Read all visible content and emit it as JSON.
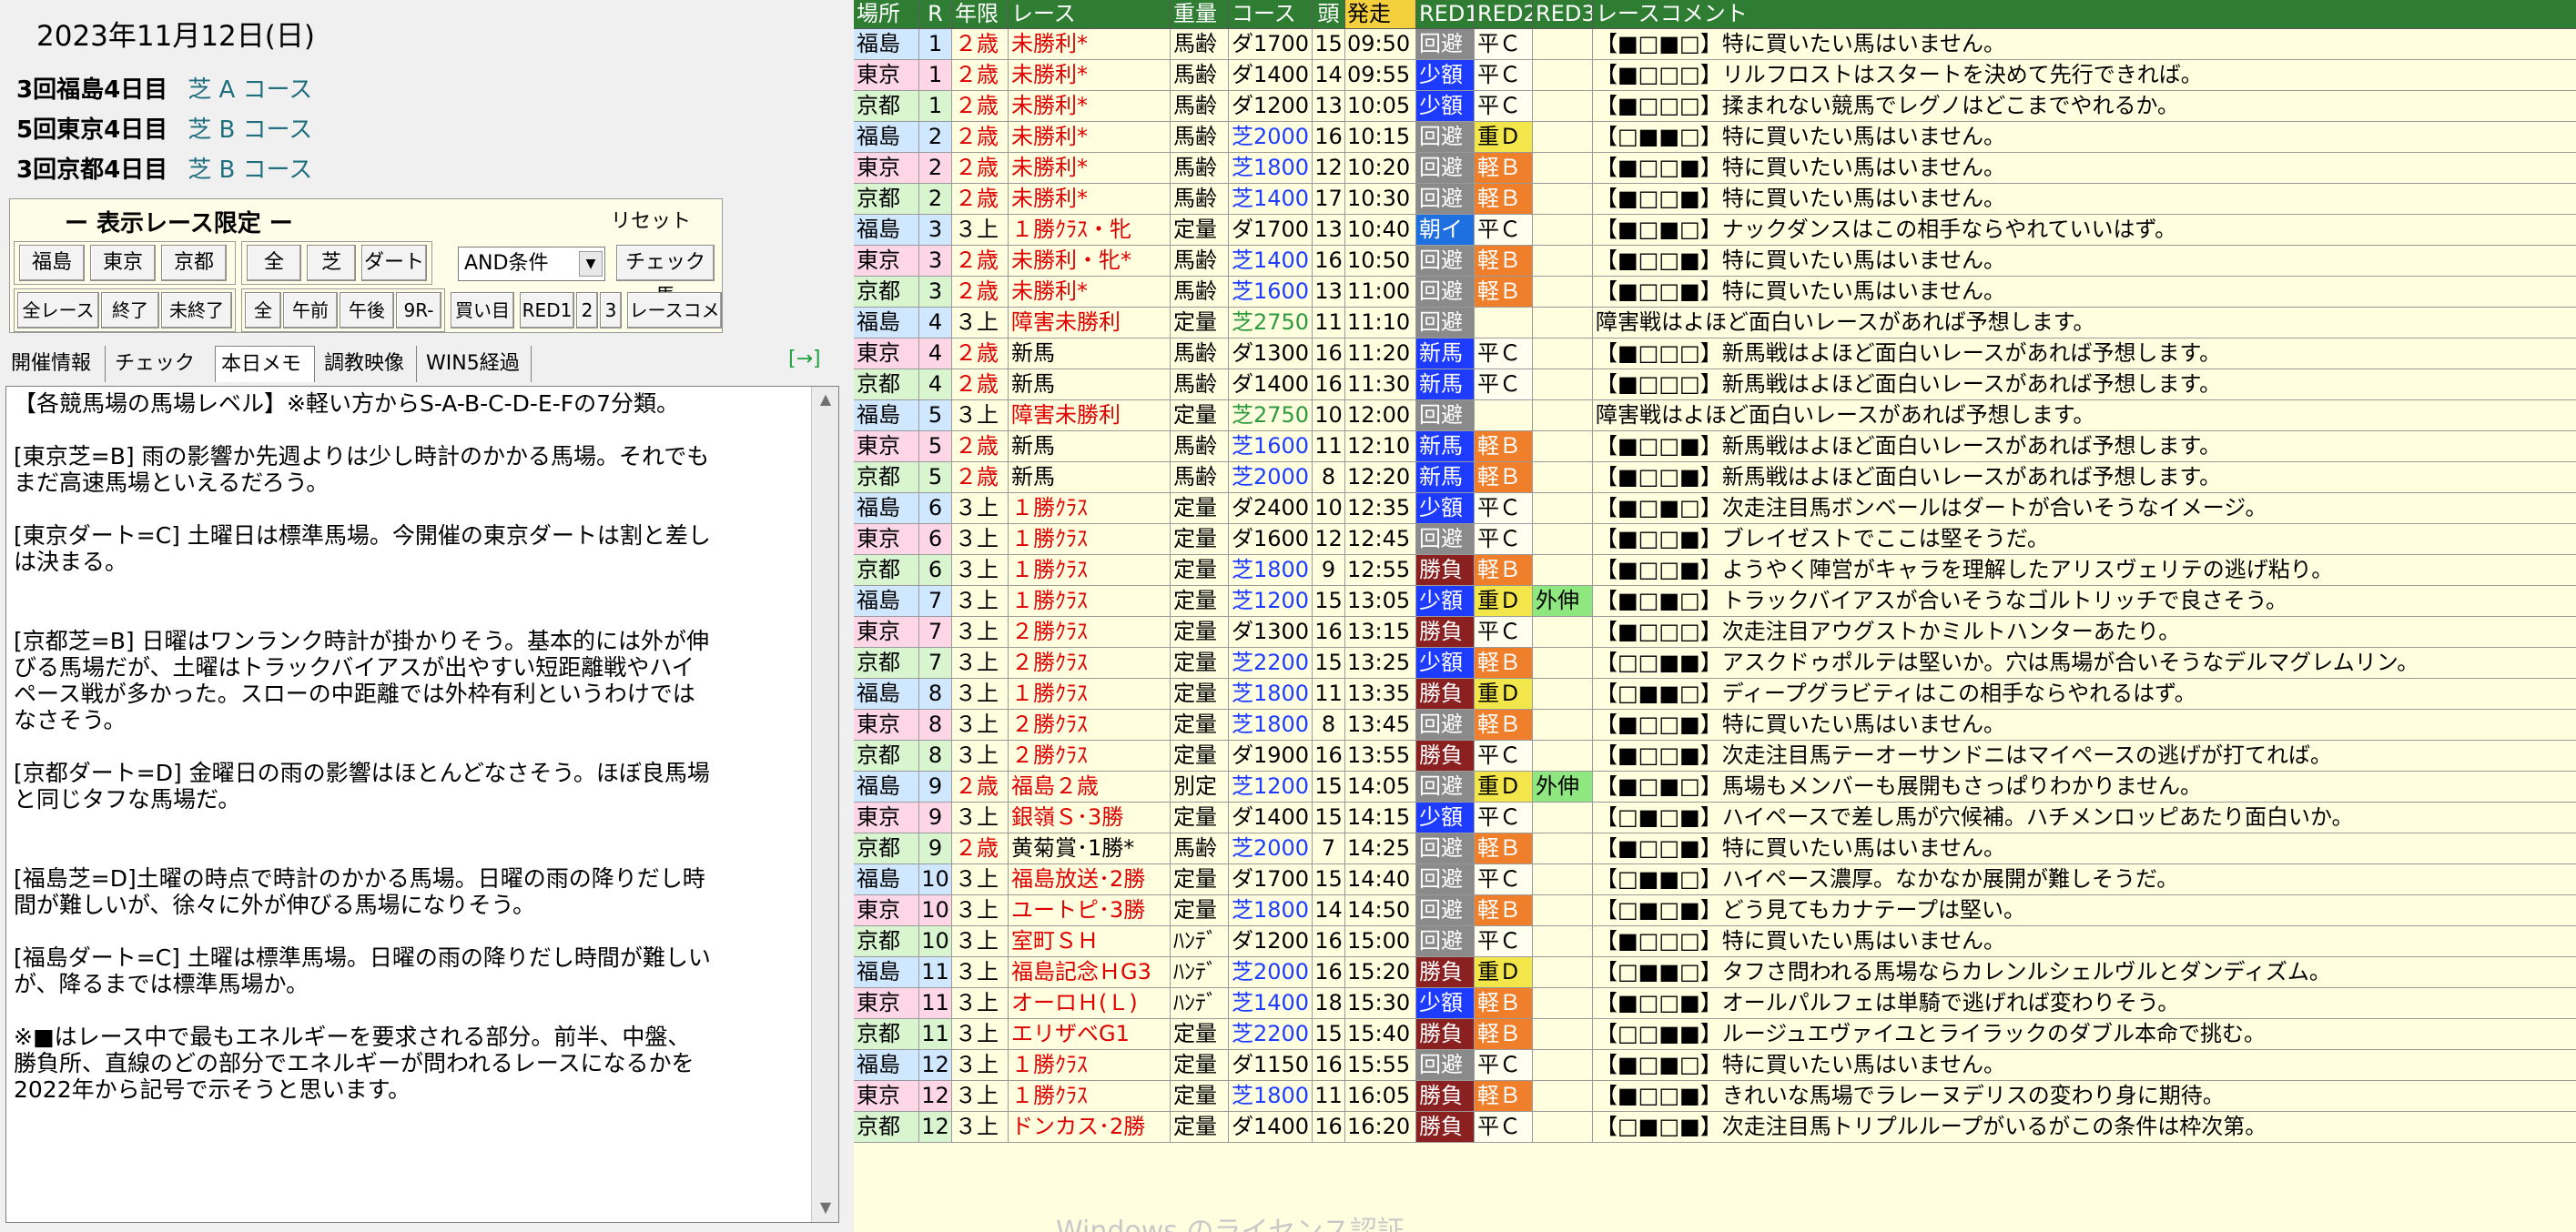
{
  "date": "2023年11月12日(日)",
  "meetings": [
    {
      "name": "3回福島4日目",
      "course": "芝 A コース"
    },
    {
      "name": "5回東京4日目",
      "course": "芝 B コース"
    },
    {
      "name": "3回京都4日目",
      "course": "芝 B コース"
    }
  ],
  "filter": {
    "title": "ー 表示レース限定 ー",
    "reset": "リセット",
    "place_buttons": [
      "福島",
      "東京",
      "京都"
    ],
    "surface_buttons": [
      "全",
      "芝",
      "ダート"
    ],
    "and_condition": "AND条件",
    "check_horse": "チェック馬",
    "row2_buttons": [
      "全レース",
      "終了",
      "未終了"
    ],
    "time_buttons": [
      "全",
      "午前",
      "午後",
      "9R-"
    ],
    "buy_button": "買い目",
    "red_buttons": [
      "RED1",
      "2",
      "3"
    ],
    "comment_button": "レースコメ"
  },
  "tabs": [
    "開催情報",
    "チェック馬",
    "本日メモ",
    "調教映像",
    "WIN5経過"
  ],
  "expand_icon": "[→]",
  "memo": "【各競馬場の馬場レベル】※軽い方からS-A-B-C-D-E-Fの7分類。\n\n[東京芝=B] 雨の影響か先週よりは少し時計のかかる馬場。それでも\nまだ高速馬場といえるだろう。\n\n[東京ダート=C] 土曜日は標準馬場。今開催の東京ダートは割と差し\nは決まる。\n\n\n[京都芝=B] 日曜はワンランク時計が掛かりそう。基本的には外が伸\nびる馬場だが、土曜はトラックバイアスが出やすい短距離戦やハイ\nペース戦が多かった。スローの中距離では外枠有利というわけでは\nなさそう。\n\n[京都ダート=D] 金曜日の雨の影響はほとんどなさそう。ほぼ良馬場\nと同じタフな馬場だ。\n\n\n[福島芝=D]土曜の時点で時計のかかる馬場。日曜の雨の降りだし時\n間が難しいが、徐々に外が伸びる馬場になりそう。\n\n[福島ダート=C] 土曜は標準馬場。日曜の雨の降りだし時間が難しい\nが、降るまでは標準馬場か。\n\n※■はレース中で最もエネルギーを要求される部分。前半、中盤、\n勝負所、直線のどの部分でエネルギーが問われるレースになるかを\n2022年から記号で示そうと思います。",
  "grid": {
    "headers": [
      "場所",
      "R",
      "年限",
      "レース",
      "重量",
      "コース",
      "頭",
      "発走",
      "RED1",
      "RED2",
      "RED3",
      "レースコメント"
    ],
    "rows": [
      [
        "福島",
        "1",
        "２歳",
        "未勝利*",
        "馬齢",
        "ダ1700",
        "15",
        "09:50",
        "回避",
        "平Ｃ",
        "",
        "【■□■□】特に買いたい馬はいません。"
      ],
      [
        "東京",
        "1",
        "２歳",
        "未勝利*",
        "馬齢",
        "ダ1400",
        "14",
        "09:55",
        "少額",
        "平Ｃ",
        "",
        "【■□□□】リルフロストはスタートを決めて先行できれば。"
      ],
      [
        "京都",
        "1",
        "２歳",
        "未勝利*",
        "馬齢",
        "ダ1200",
        "13",
        "10:05",
        "少額",
        "平Ｃ",
        "",
        "【■□□□】揉まれない競馬でレグノはどこまでやれるか。"
      ],
      [
        "福島",
        "2",
        "２歳",
        "未勝利*",
        "馬齢",
        "芝2000",
        "16",
        "10:15",
        "回避",
        "重Ｄ",
        "",
        "【□■■□】特に買いたい馬はいません。"
      ],
      [
        "東京",
        "2",
        "２歳",
        "未勝利*",
        "馬齢",
        "芝1800",
        "12",
        "10:20",
        "回避",
        "軽Ｂ",
        "",
        "【■□□■】特に買いたい馬はいません。"
      ],
      [
        "京都",
        "2",
        "２歳",
        "未勝利*",
        "馬齢",
        "芝1400",
        "17",
        "10:30",
        "回避",
        "軽Ｂ",
        "",
        "【■□□■】特に買いたい馬はいません。"
      ],
      [
        "福島",
        "3",
        "３上",
        "１勝ｸﾗｽ・牝",
        "定量",
        "ダ1700",
        "13",
        "10:40",
        "朝イ",
        "平Ｃ",
        "",
        "【■□■□】ナックダンスはこの相手ならやれていいはず。"
      ],
      [
        "東京",
        "3",
        "２歳",
        "未勝利・牝*",
        "馬齢",
        "芝1400",
        "16",
        "10:50",
        "回避",
        "軽Ｂ",
        "",
        "【■□□■】特に買いたい馬はいません。"
      ],
      [
        "京都",
        "3",
        "２歳",
        "未勝利*",
        "馬齢",
        "芝1600",
        "13",
        "11:00",
        "回避",
        "軽Ｂ",
        "",
        "【■□□■】特に買いたい馬はいません。"
      ],
      [
        "福島",
        "4",
        "３上",
        "障害未勝利",
        "定量",
        "芝2750",
        "11",
        "11:10",
        "回避",
        "",
        "",
        "障害戦はよほど面白いレースがあれば予想します。"
      ],
      [
        "東京",
        "4",
        "２歳",
        "新馬",
        "馬齢",
        "ダ1300",
        "16",
        "11:20",
        "新馬",
        "平Ｃ",
        "",
        "【■□□□】新馬戦はよほど面白いレースがあれば予想します。"
      ],
      [
        "京都",
        "4",
        "２歳",
        "新馬",
        "馬齢",
        "ダ1400",
        "16",
        "11:30",
        "新馬",
        "平Ｃ",
        "",
        "【■□□□】新馬戦はよほど面白いレースがあれば予想します。"
      ],
      [
        "福島",
        "5",
        "３上",
        "障害未勝利",
        "定量",
        "芝2750",
        "10",
        "12:00",
        "回避",
        "",
        "",
        "障害戦はよほど面白いレースがあれば予想します。"
      ],
      [
        "東京",
        "5",
        "２歳",
        "新馬",
        "馬齢",
        "芝1600",
        "11",
        "12:10",
        "新馬",
        "軽Ｂ",
        "",
        "【■□□■】新馬戦はよほど面白いレースがあれば予想します。"
      ],
      [
        "京都",
        "5",
        "２歳",
        "新馬",
        "馬齢",
        "芝2000",
        "8",
        "12:20",
        "新馬",
        "軽Ｂ",
        "",
        "【■□□■】新馬戦はよほど面白いレースがあれば予想します。"
      ],
      [
        "福島",
        "6",
        "３上",
        "１勝ｸﾗｽ",
        "定量",
        "ダ2400",
        "10",
        "12:35",
        "少額",
        "平Ｃ",
        "",
        "【■□■□】次走注目馬ボンベールはダートが合いそうなイメージ。"
      ],
      [
        "東京",
        "6",
        "３上",
        "１勝ｸﾗｽ",
        "定量",
        "ダ1600",
        "12",
        "12:45",
        "回避",
        "平Ｃ",
        "",
        "【■□□■】ブレイゼストでここは堅そうだ。"
      ],
      [
        "京都",
        "6",
        "３上",
        "１勝ｸﾗｽ",
        "定量",
        "芝1800",
        "9",
        "12:55",
        "勝負",
        "軽Ｂ",
        "",
        "【■□□■】ようやく陣営がキャラを理解したアリスヴェリテの逃げ粘り。"
      ],
      [
        "福島",
        "7",
        "３上",
        "１勝ｸﾗｽ",
        "定量",
        "芝1200",
        "15",
        "13:05",
        "少額",
        "重Ｄ",
        "外伸",
        "【■□■□】トラックバイアスが合いそうなゴルトリッチで良さそう。"
      ],
      [
        "東京",
        "7",
        "３上",
        "２勝ｸﾗｽ",
        "定量",
        "ダ1300",
        "16",
        "13:15",
        "勝負",
        "平Ｃ",
        "",
        "【■□□□】次走注目アウグストかミルトハンターあたり。"
      ],
      [
        "京都",
        "7",
        "３上",
        "２勝ｸﾗｽ",
        "定量",
        "芝2200",
        "15",
        "13:25",
        "少額",
        "軽Ｂ",
        "",
        "【□□■■】アスクドゥポルテは堅いか。穴は馬場が合いそうなデルマグレムリン。"
      ],
      [
        "福島",
        "8",
        "３上",
        "１勝ｸﾗｽ",
        "定量",
        "芝1800",
        "11",
        "13:35",
        "勝負",
        "重Ｄ",
        "",
        "【□■■□】ディープグラビティはこの相手ならやれるはず。"
      ],
      [
        "東京",
        "8",
        "３上",
        "２勝ｸﾗｽ",
        "定量",
        "芝1800",
        "8",
        "13:45",
        "回避",
        "軽Ｂ",
        "",
        "【■□□■】特に買いたい馬はいません。"
      ],
      [
        "京都",
        "8",
        "３上",
        "２勝ｸﾗｽ",
        "定量",
        "ダ1900",
        "16",
        "13:55",
        "勝負",
        "平Ｃ",
        "",
        "【■□□■】次走注目馬テーオーサンドニはマイペースの逃げが打てれば。"
      ],
      [
        "福島",
        "9",
        "２歳",
        "福島２歳",
        "別定",
        "芝1200",
        "15",
        "14:05",
        "回避",
        "重Ｄ",
        "外伸",
        "【■□■□】馬場もメンバーも展開もさっぱりわかりません。"
      ],
      [
        "東京",
        "9",
        "３上",
        "銀嶺Ｓ･3勝",
        "定量",
        "ダ1400",
        "15",
        "14:15",
        "少額",
        "平Ｃ",
        "",
        "【□■□■】ハイペースで差し馬が穴候補。ハチメンロッピあたり面白いか。"
      ],
      [
        "京都",
        "9",
        "２歳",
        "黄菊賞･1勝*",
        "馬齢",
        "芝2000",
        "7",
        "14:25",
        "回避",
        "軽Ｂ",
        "",
        "【■□□■】特に買いたい馬はいません。"
      ],
      [
        "福島",
        "10",
        "３上",
        "福島放送･2勝",
        "定量",
        "ダ1700",
        "15",
        "14:40",
        "回避",
        "平Ｃ",
        "",
        "【□■■□】ハイペース濃厚。なかなか展開が難しそうだ。"
      ],
      [
        "東京",
        "10",
        "３上",
        "ユートピ･3勝",
        "定量",
        "芝1800",
        "14",
        "14:50",
        "回避",
        "軽Ｂ",
        "",
        "【□■□■】どう見てもカナテープは堅い。"
      ],
      [
        "京都",
        "10",
        "３上",
        "室町ＳＨ",
        "ﾊﾝﾃﾞ",
        "ダ1200",
        "16",
        "15:00",
        "回避",
        "平Ｃ",
        "",
        "【■□□□】特に買いたい馬はいません。"
      ],
      [
        "福島",
        "11",
        "３上",
        "福島記念ＨG3",
        "ﾊﾝﾃﾞ",
        "芝2000",
        "16",
        "15:20",
        "勝負",
        "重Ｄ",
        "",
        "【□■■□】タフさ問われる馬場ならカレンルシェルヴルとダンディズム。"
      ],
      [
        "東京",
        "11",
        "３上",
        "オーロＨ(Ｌ)",
        "ﾊﾝﾃﾞ",
        "芝1400",
        "18",
        "15:30",
        "少額",
        "軽Ｂ",
        "",
        "【■□□■】オールパルフェは単騎で逃げれば変わりそう。"
      ],
      [
        "京都",
        "11",
        "３上",
        "エリザベG1",
        "定量",
        "芝2200",
        "15",
        "15:40",
        "勝負",
        "軽Ｂ",
        "",
        "【□□■■】ルージュエヴァイユとライラックのダブル本命で挑む。"
      ],
      [
        "福島",
        "12",
        "３上",
        "１勝ｸﾗｽ",
        "定量",
        "ダ1150",
        "16",
        "15:55",
        "回避",
        "平Ｃ",
        "",
        "【■□■□】特に買いたい馬はいません。"
      ],
      [
        "東京",
        "12",
        "３上",
        "１勝ｸﾗｽ",
        "定量",
        "芝1800",
        "11",
        "16:05",
        "勝負",
        "軽Ｂ",
        "",
        "【■□□■】きれいな馬場でラレーヌデリスの変わり身に期待。"
      ],
      [
        "京都",
        "12",
        "３上",
        "ドンカス･2勝",
        "定量",
        "ダ1400",
        "16",
        "16:20",
        "勝負",
        "平Ｃ",
        "",
        "【□■□■】次走注目馬トリプルループがいるがこの条件は枠次第。"
      ]
    ]
  },
  "watermark": "Windows のライセンス認証"
}
